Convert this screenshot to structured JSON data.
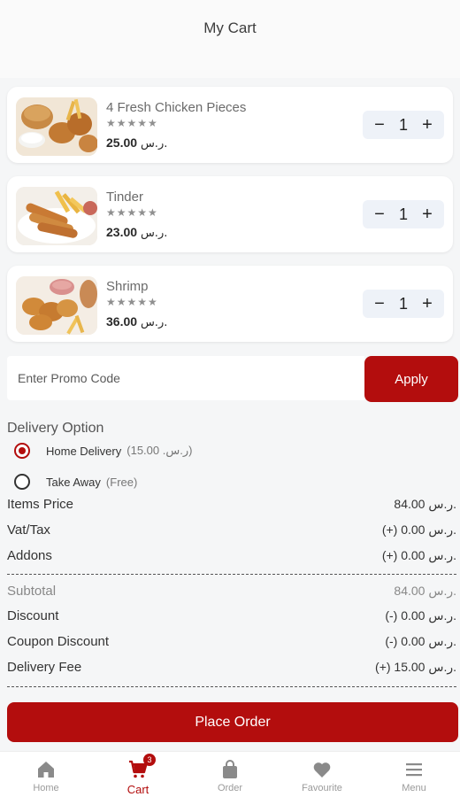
{
  "header": {
    "title": "My Cart"
  },
  "cart": {
    "items": [
      {
        "name": "4 Fresh Chicken Pieces",
        "rating": "★★★★★",
        "price": "25.00",
        "currency": "ر.س.",
        "qty": "1",
        "image_icon": "fried-chicken-image"
      },
      {
        "name": "Tinder",
        "rating": "★★★★★",
        "price": "23.00",
        "currency": "ر.س.",
        "qty": "1",
        "image_icon": "chicken-tenders-image"
      },
      {
        "name": "Shrimp",
        "rating": "★★★★★",
        "price": "36.00",
        "currency": "ر.س.",
        "qty": "1",
        "image_icon": "fried-shrimp-image"
      }
    ],
    "qty_minus": "−",
    "qty_plus": "+"
  },
  "promo": {
    "placeholder": "Enter Promo Code",
    "apply_label": "Apply"
  },
  "delivery": {
    "title": "Delivery Option",
    "options": [
      {
        "label": "Home Delivery",
        "extra": "(ر.س. 15.00)",
        "selected": true
      },
      {
        "label": "Take Away",
        "extra": "(Free)",
        "selected": false
      }
    ]
  },
  "summary": {
    "items_price": {
      "label": "Items Price",
      "value": "84.00 ر.س."
    },
    "vat": {
      "label": "Vat/Tax",
      "value": "(+) 0.00 ر.س."
    },
    "addons": {
      "label": "Addons",
      "value": "(+) 0.00 ر.س."
    },
    "subtotal": {
      "label": "Subtotal",
      "value": "84.00 ر.س."
    },
    "discount": {
      "label": "Discount",
      "value": "(-) 0.00 ر.س."
    },
    "coupon_discount": {
      "label": "Coupon Discount",
      "value": "(-) 0.00 ر.س."
    },
    "delivery_fee": {
      "label": "Delivery Fee",
      "value": "(+) 15.00 ر.س."
    }
  },
  "place_order_label": "Place Order",
  "nav": {
    "items": [
      {
        "label": "Home",
        "icon": "home-icon",
        "active": false
      },
      {
        "label": "Cart",
        "icon": "cart-icon",
        "active": true,
        "badge": "3"
      },
      {
        "label": "Order",
        "icon": "shopping-bag-icon",
        "active": false
      },
      {
        "label": "Favourite",
        "icon": "heart-icon",
        "active": false
      },
      {
        "label": "Menu",
        "icon": "menu-icon",
        "active": false
      }
    ]
  },
  "colors": {
    "accent": "#b30d0d",
    "background": "#f5f6f7",
    "card": "#ffffff",
    "qty_bg": "#eef2f8"
  }
}
